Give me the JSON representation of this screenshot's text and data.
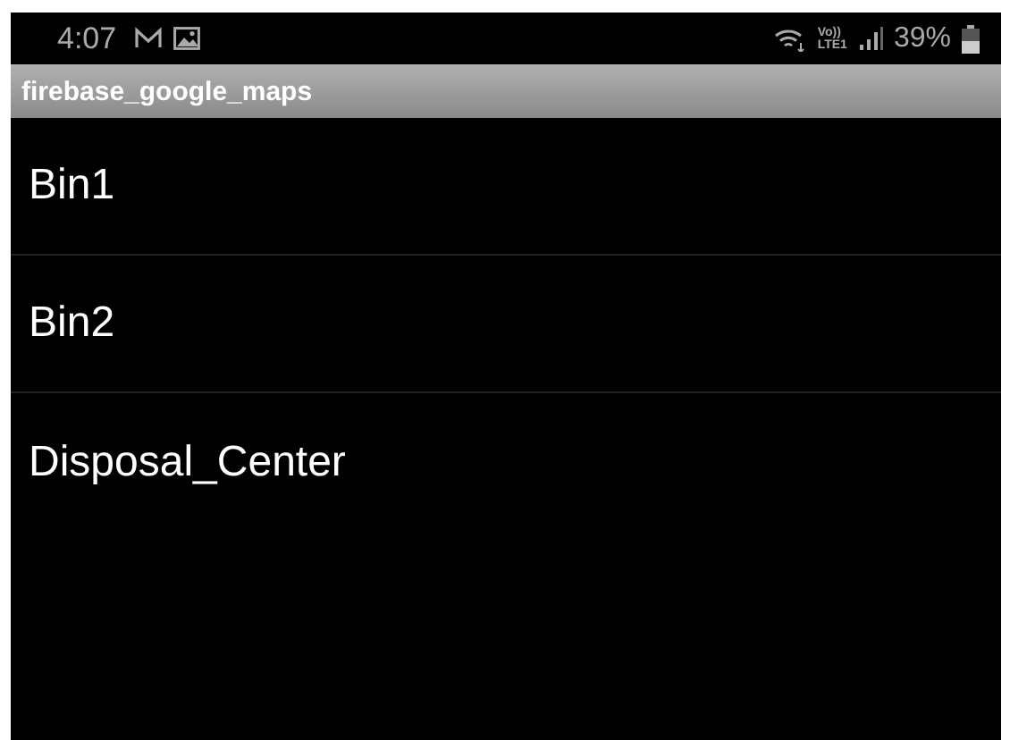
{
  "status_bar": {
    "time": "4:07",
    "volte_top": "Vo))",
    "volte_bottom": "LTE1",
    "battery": "39%"
  },
  "app_bar": {
    "title": "firebase_google_maps"
  },
  "list": [
    {
      "label": "Bin1"
    },
    {
      "label": "Bin2"
    },
    {
      "label": "Disposal_Center"
    }
  ]
}
